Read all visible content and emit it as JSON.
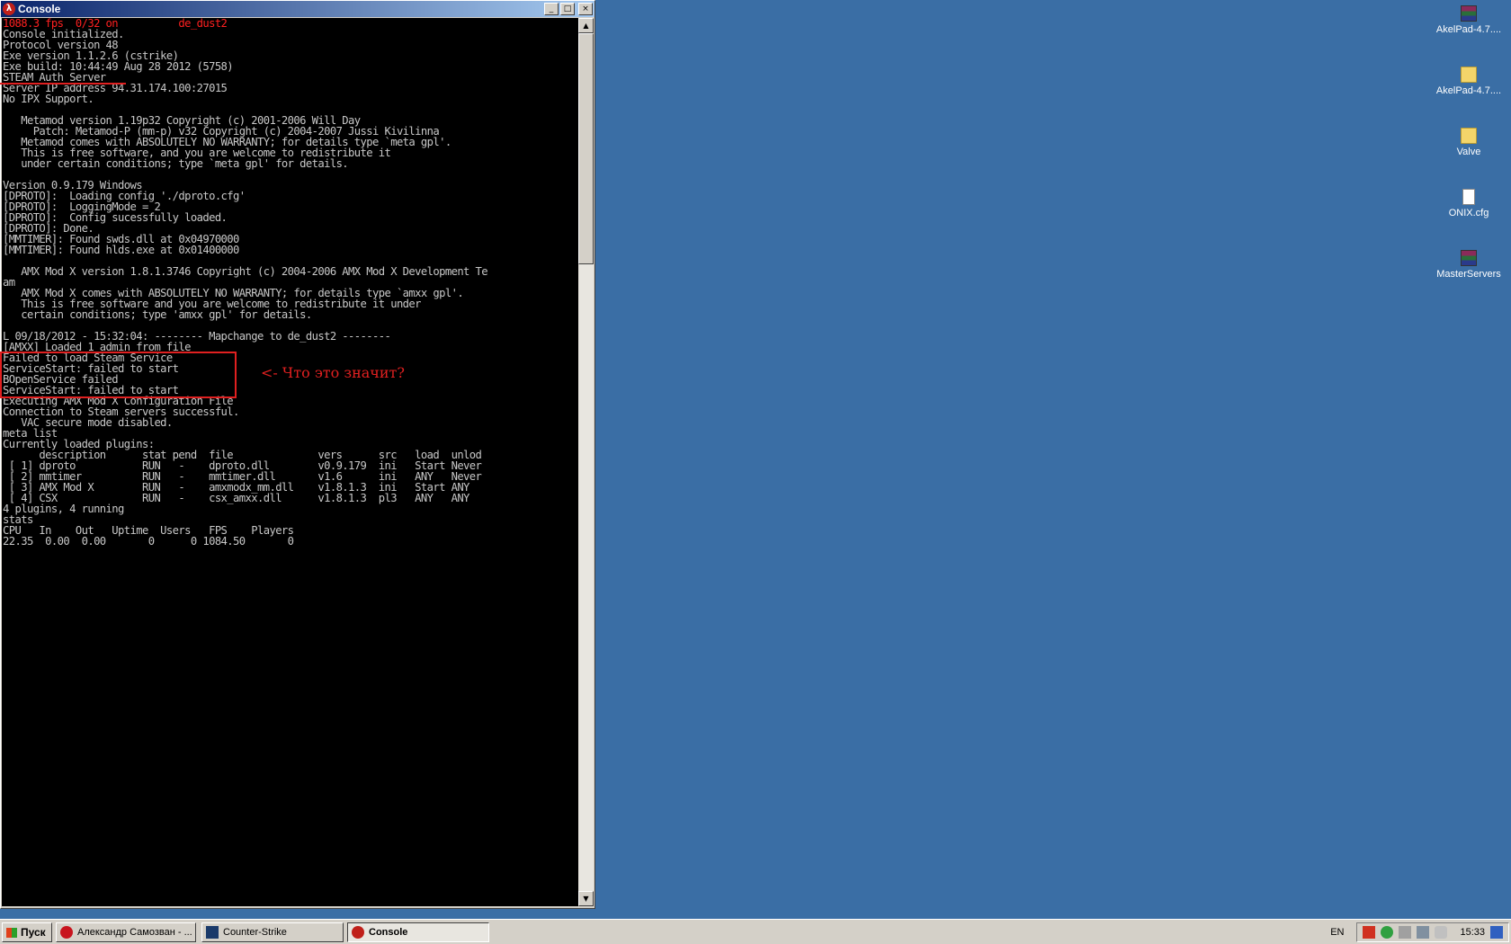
{
  "window": {
    "title": "Console",
    "buttons": {
      "minimize": "_",
      "maximize": "□",
      "close": "×"
    }
  },
  "console": {
    "header_line": "1088.3 fps  0/32 on          de_dust2",
    "lines": [
      "Console initialized.",
      "Protocol version 48",
      "Exe version 1.1.2.6 (cstrike)",
      "Exe build: 10:44:49 Aug 28 2012 (5758)",
      "STEAM Auth Server",
      "Server IP address 94.31.174.100:27015",
      "No IPX Support.",
      "",
      "   Metamod version 1.19p32 Copyright (c) 2001-2006 Will Day",
      "     Patch: Metamod-P (mm-p) v32 Copyright (c) 2004-2007 Jussi Kivilinna",
      "   Metamod comes with ABSOLUTELY NO WARRANTY; for details type `meta gpl'.",
      "   This is free software, and you are welcome to redistribute it",
      "   under certain conditions; type `meta gpl' for details.",
      "",
      "Version 0.9.179 Windows",
      "[DPROTO]:  Loading config './dproto.cfg'",
      "[DPROTO]:  LoggingMode = 2",
      "[DPROTO]:  Config sucessfully loaded.",
      "[DPROTO]: Done.",
      "[MMTIMER]: Found swds.dll at 0x04970000",
      "[MMTIMER]: Found hlds.exe at 0x01400000",
      "",
      "   AMX Mod X version 1.8.1.3746 Copyright (c) 2004-2006 AMX Mod X Development Te",
      "am",
      "   AMX Mod X comes with ABSOLUTELY NO WARRANTY; for details type `amxx gpl'.",
      "   This is free software and you are welcome to redistribute it under",
      "   certain conditions; type 'amxx gpl' for details.",
      "",
      "L 09/18/2012 - 15:32:04: -------- Mapchange to de_dust2 --------",
      "[AMXX] Loaded 1 admin from file",
      "Failed to load Steam Service",
      "ServiceStart: failed to start",
      "BOpenService failed",
      "ServiceStart: failed to start",
      "Executing AMX Mod X Configuration File",
      "Connection to Steam servers successful.",
      "   VAC secure mode disabled.",
      "meta list",
      "Currently loaded plugins:",
      "      description      stat pend  file              vers      src   load  unlod",
      " [ 1] dproto           RUN   -    dproto.dll        v0.9.179  ini   Start Never",
      " [ 2] mmtimer          RUN   -    mmtimer.dll       v1.6      ini   ANY   Never",
      " [ 3] AMX Mod X        RUN   -    amxmodx_mm.dll    v1.8.1.3  ini   Start ANY",
      " [ 4] CSX              RUN   -    csx_amxx.dll      v1.8.1.3  pl3   ANY   ANY",
      "4 plugins, 4 running",
      "stats",
      "CPU   In    Out   Uptime  Users   FPS    Players",
      "22.35  0.00  0.00       0      0 1084.50       0"
    ]
  },
  "annotation": "<- Что это значит?",
  "desktop_icons": [
    {
      "label": "AkelPad-4.7....",
      "icon": "rar-archive-icon"
    },
    {
      "label": "AkelPad-4.7....",
      "icon": "folder-icon"
    },
    {
      "label": "Valve",
      "icon": "folder-icon"
    },
    {
      "label": "ONIX.cfg",
      "icon": "file-icon"
    },
    {
      "label": "MasterServers",
      "icon": "rar-archive-icon"
    }
  ],
  "taskbar": {
    "start_label": "Пуск",
    "tasks": [
      {
        "label": "Александр Самозван - ...",
        "icon": "opera-icon",
        "active": false
      },
      {
        "label": "Counter-Strike",
        "icon": "counter-strike-icon",
        "active": false
      },
      {
        "label": "Console",
        "icon": "half-life-icon",
        "active": true
      }
    ],
    "language": "EN",
    "clock": "15:33"
  }
}
